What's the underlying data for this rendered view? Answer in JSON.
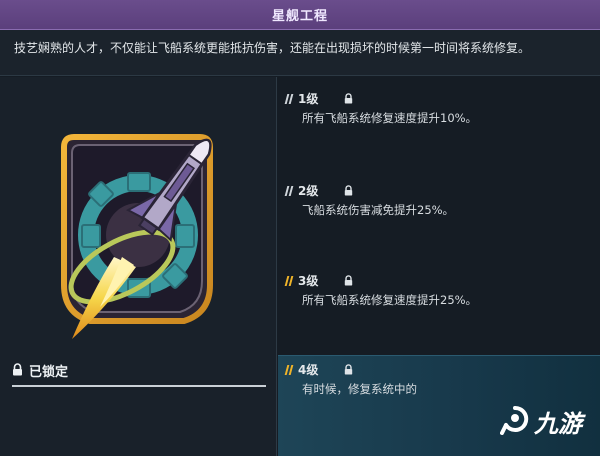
{
  "header": {
    "title": "星舰工程"
  },
  "description": "技艺娴熟的人才，不仅能让飞船系统更能抵抗伤害，还能在出现损坏的时候第一时间将系统修复。",
  "status": {
    "lock_label": "已锁定",
    "icon": "lock-icon"
  },
  "badge": {
    "icon": "spaceship-engineering-badge-icon"
  },
  "levels": [
    {
      "name": "1级",
      "desc": "所有飞船系统修复速度提升10%。",
      "active_stripes": 0
    },
    {
      "name": "2级",
      "desc": "飞船系统伤害减免提升25%。",
      "active_stripes": 0
    },
    {
      "name": "3级",
      "desc": "所有飞船系统修复速度提升25%。",
      "active_stripes": 1
    },
    {
      "name": "4级",
      "desc": "有时候，修复系统中的",
      "active_stripes": 1
    }
  ],
  "watermark": {
    "text": "九游",
    "icon": "jiuyou-logo-icon"
  },
  "colors": {
    "title_bar": "#5b3f7c",
    "accent_yellow": "#f0b429",
    "stripe_inactive": "#cfd5da",
    "selected_row": "#17384a"
  }
}
